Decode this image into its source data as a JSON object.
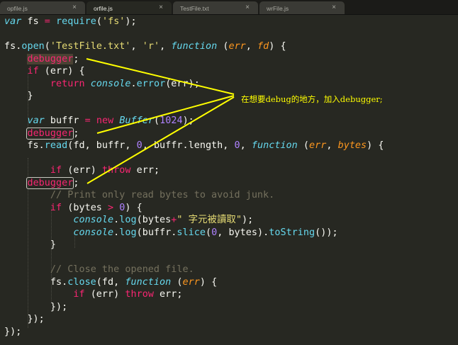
{
  "tabs": [
    {
      "label": "opfile.js",
      "active": false
    },
    {
      "label": "orfile.js",
      "active": true
    },
    {
      "label": "TestFile.txt",
      "active": false
    },
    {
      "label": "wrFile.js",
      "active": false
    }
  ],
  "tab_close_glyph": "×",
  "annotation": "在想要debug的地方，加入debugger;",
  "colors": {
    "background": "#272822",
    "keyword": "#66d9ef",
    "operator": "#f92672",
    "string": "#e6db74",
    "number": "#ae81ff",
    "parameter": "#fd971f",
    "comment": "#75715e",
    "annotation": "#ffff00"
  },
  "code": {
    "l1": {
      "a": "var",
      "b": " fs ",
      "c": "=",
      "d": " ",
      "e": "require",
      "f": "(",
      "g": "'fs'",
      "h": ");"
    },
    "l3": {
      "a": "fs.",
      "b": "open",
      "c": "(",
      "d": "'TestFile.txt'",
      "e": ", ",
      "f": "'r'",
      "g": ", ",
      "h": "function",
      "i": " (",
      "j": "err",
      "k": ", ",
      "l": "fd",
      "m": ") {"
    },
    "l4": {
      "a": "    ",
      "b": "debugger",
      "c": ";"
    },
    "l5": {
      "a": "    ",
      "b": "if",
      "c": " (err) {"
    },
    "l6": {
      "a": "        ",
      "b": "return",
      "c": " ",
      "d": "console",
      "e": ".",
      "f": "error",
      "g": "(err);"
    },
    "l7": {
      "a": "    }"
    },
    "l9": {
      "a": "    ",
      "b": "var",
      "c": " buffr ",
      "d": "=",
      "e": " ",
      "f": "new",
      "g": " ",
      "h": "Buffer",
      "i": "(",
      "j": "1024",
      "k": ");"
    },
    "l10": {
      "a": "    ",
      "b": "debugger",
      "c": ";"
    },
    "l11": {
      "a": "    fs.",
      "b": "read",
      "c": "(fd, buffr, ",
      "d": "0",
      "e": ", buffr.length, ",
      "f": "0",
      "g": ", ",
      "h": "function",
      "i": " (",
      "j": "err",
      "k": ", ",
      "l": "bytes",
      "m": ") {"
    },
    "l13": {
      "a": "        ",
      "b": "if",
      "c": " (err) ",
      "d": "throw",
      "e": " err;"
    },
    "l14": {
      "a": "    ",
      "b": "debugger",
      "c": ";"
    },
    "l15": {
      "a": "        ",
      "b": "// Print only read bytes to avoid junk."
    },
    "l16": {
      "a": "        ",
      "b": "if",
      "c": " (bytes ",
      "d": ">",
      "e": " ",
      "f": "0",
      "g": ") {"
    },
    "l17": {
      "a": "            ",
      "b": "console",
      "c": ".",
      "d": "log",
      "e": "(bytes",
      "f": "+",
      "g": "\" ",
      "h": "字元被讀取",
      "i": "\"",
      "j": ");"
    },
    "l18": {
      "a": "            ",
      "b": "console",
      "c": ".",
      "d": "log",
      "e": "(buffr.",
      "f": "slice",
      "g": "(",
      "h": "0",
      "i": ", bytes).",
      "j": "toString",
      "k": "());"
    },
    "l19": {
      "a": "        }"
    },
    "l21": {
      "a": "        ",
      "b": "// Close the opened file."
    },
    "l22": {
      "a": "        fs.",
      "b": "close",
      "c": "(fd, ",
      "d": "function",
      "e": " (",
      "f": "err",
      "g": ") {"
    },
    "l23": {
      "a": "            ",
      "b": "if",
      "c": " (err) ",
      "d": "throw",
      "e": " err;"
    },
    "l24": {
      "a": "        });"
    },
    "l25": {
      "a": "    });"
    },
    "l26": {
      "a": "});"
    }
  }
}
